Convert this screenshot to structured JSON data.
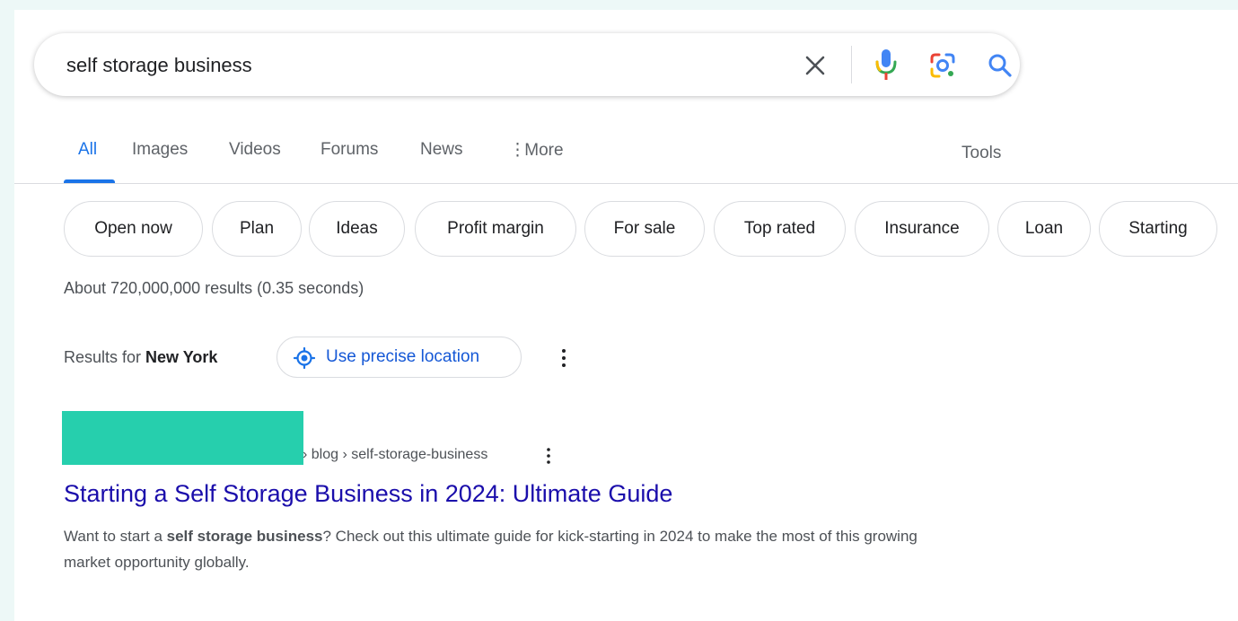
{
  "search": {
    "query": "self storage business"
  },
  "tabs": [
    {
      "label": "All",
      "active": true
    },
    {
      "label": "Images"
    },
    {
      "label": "Videos"
    },
    {
      "label": "Forums"
    },
    {
      "label": "News"
    },
    {
      "label": "More"
    }
  ],
  "tools_label": "Tools",
  "chips": [
    "Open now",
    "Plan",
    "Ideas",
    "Profit margin",
    "For sale",
    "Top rated",
    "Insurance",
    "Loan",
    "Starting"
  ],
  "stats": "About 720,000,000 results (0.35 seconds)",
  "location": {
    "prefix": "Results for ",
    "place": "New York",
    "button_label": "Use precise location"
  },
  "result": {
    "breadcrumb": "› blog › self-storage-business",
    "title": "Starting a Self Storage Business in 2024: Ultimate Guide",
    "snippet_before": "Want to start a ",
    "snippet_bold": "self storage business",
    "snippet_after": "? Check out this ultimate guide for kick-starting in 2024 to make the most of this growing market opportunity globally."
  },
  "colors": {
    "accent": "#1a73e8",
    "link": "#1a0dab",
    "redaction": "#26cfad",
    "background": "#edf8f7"
  },
  "icons": [
    "clear-icon",
    "mic-icon",
    "lens-icon",
    "search-icon",
    "more-vert-icon",
    "location-icon"
  ]
}
